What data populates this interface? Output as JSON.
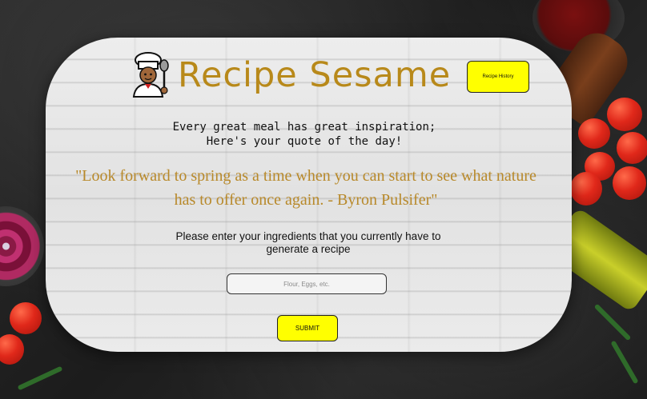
{
  "header": {
    "app_title": "Recipe Sesame",
    "logo_icon": "chef-icon",
    "history_button": "Recipe History"
  },
  "intro": {
    "line1": "Every great meal has great inspiration;",
    "line2": "Here's your quote of the day!"
  },
  "quote": {
    "text": "\"Look forward to spring as a time when you can start to see what nature has to offer once again. - Byron Pulsifer\""
  },
  "form": {
    "prompt": "Please enter your ingredients that you currently have to generate a recipe",
    "input_placeholder": "Flour, Eggs, etc.",
    "input_value": "",
    "submit_label": "SUBMIT"
  },
  "colors": {
    "accent_gold": "#b8891a",
    "button_yellow": "#ffff00"
  }
}
